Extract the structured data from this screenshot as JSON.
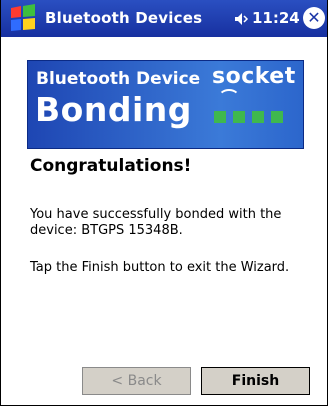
{
  "titlebar": {
    "title": "Bluetooth Devices",
    "time": "11:24",
    "close_symbol": "✕",
    "start_icon": "windows-flag-icon",
    "speaker_icon": "speaker-icon"
  },
  "banner": {
    "line1": "Bluetooth Device",
    "line2": "Bonding",
    "brand": "socket"
  },
  "content": {
    "heading": "Congratulations!",
    "message1": "You have successfully bonded with the device: BTGPS 15348B.",
    "message2": "Tap the Finish button to exit the Wizard."
  },
  "buttons": {
    "back_label": "< Back",
    "finish_label": "Finish"
  },
  "colors": {
    "titlebar": "#1f3db3",
    "banner": "#2a5fc7",
    "brand_green": "#3fb84e",
    "button_face": "#d4d0c8"
  }
}
